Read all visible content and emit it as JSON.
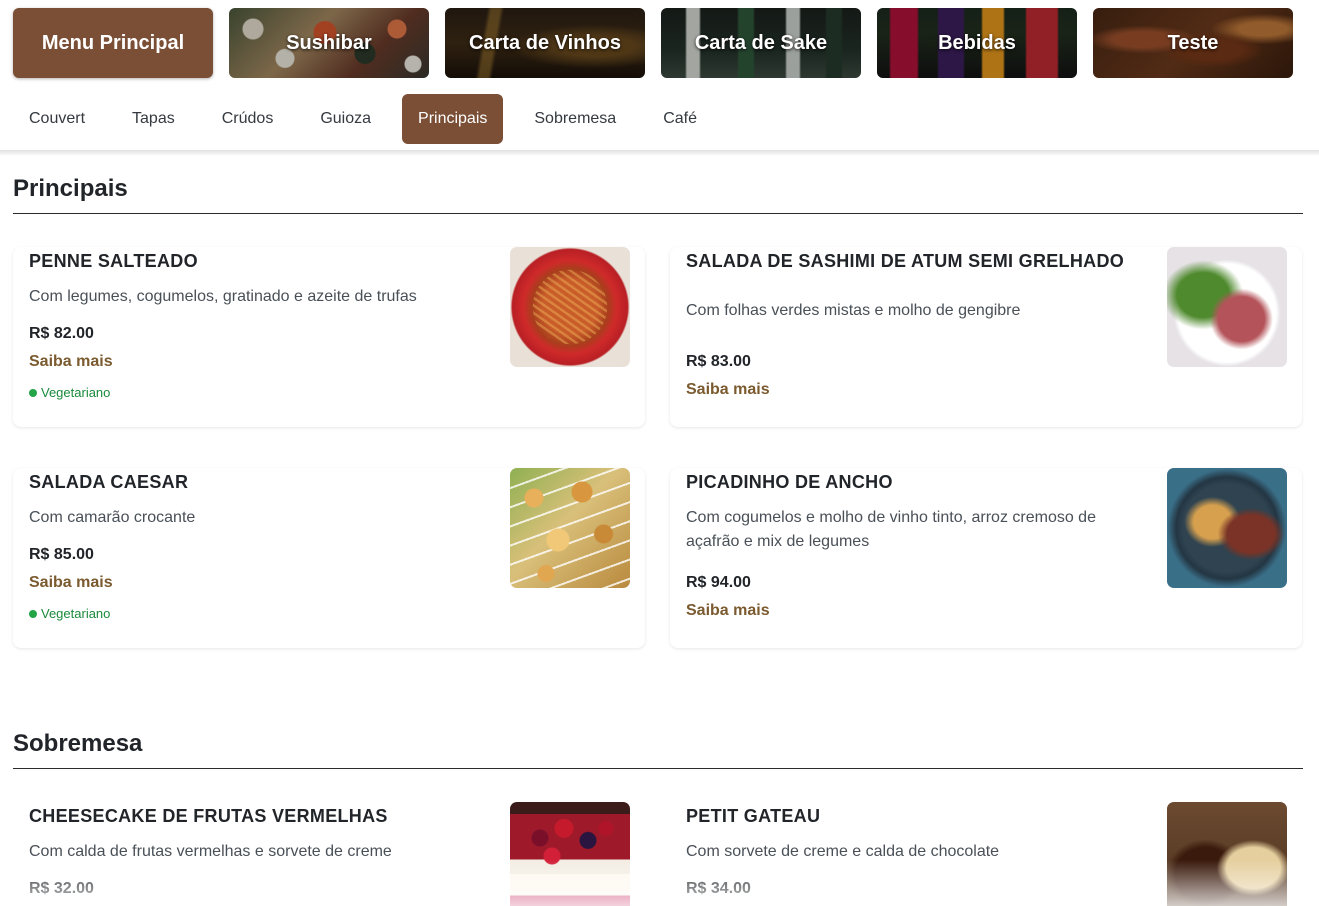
{
  "categories": [
    {
      "label": "Menu Principal",
      "active": true
    },
    {
      "label": "Sushibar",
      "active": false
    },
    {
      "label": "Carta de Vinhos",
      "active": false
    },
    {
      "label": "Carta de Sake",
      "active": false
    },
    {
      "label": "Bebidas",
      "active": false
    },
    {
      "label": "Teste",
      "active": false
    }
  ],
  "subtabs": [
    "Couvert",
    "Tapas",
    "Crúdos",
    "Guioza",
    "Principais",
    "Sobremesa",
    "Café"
  ],
  "active_subtab": "Principais",
  "colors": {
    "accent": "#7a4f36",
    "link": "#7a5a2e",
    "veg": "#22a447"
  },
  "sections": [
    {
      "title": "Principais",
      "items": [
        {
          "name": "PENNE SALTEADO",
          "description": "Com legumes, cogumelos, gratinado e azeite de trufas",
          "price": "R$ 82.00",
          "more": "Saiba mais",
          "tag": "Vegetariano"
        },
        {
          "name": "SALADA DE SASHIMI DE ATUM SEMI GRELHADO",
          "description": "Com folhas verdes mistas e molho de gengibre",
          "price": "R$ 83.00",
          "more": "Saiba mais"
        },
        {
          "name": "SALADA CAESAR",
          "description": "Com camarão crocante",
          "price": "R$ 85.00",
          "more": "Saiba mais",
          "tag": "Vegetariano"
        },
        {
          "name": "PICADINHO DE ANCHO",
          "description": "Com cogumelos e molho de vinho tinto, arroz cremoso de açafrão e mix de legumes",
          "price": "R$ 94.00",
          "more": "Saiba mais"
        }
      ]
    },
    {
      "title": "Sobremesa",
      "items": [
        {
          "name": "CHEESECAKE DE FRUTAS VERMELHAS",
          "description": "Com calda de frutas vermelhas e sorvete de creme",
          "price": "R$ 32.00"
        },
        {
          "name": "PETIT GATEAU",
          "description": "Com sorvete de creme e calda de chocolate",
          "price": "R$ 34.00"
        }
      ]
    }
  ]
}
